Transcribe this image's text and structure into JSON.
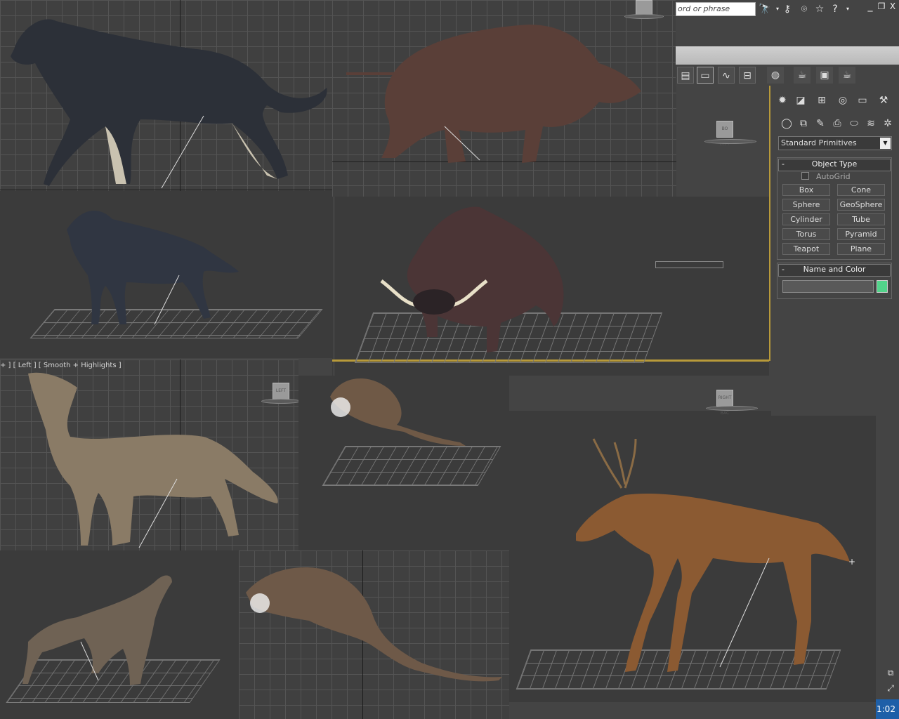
{
  "search": {
    "placeholder": "ord or phrase"
  },
  "viewport_label": "+ ] [ Left ] [ Smooth + Highlights ]",
  "viewcube": {
    "left": "LEFT",
    "front_left": "BO LEFT",
    "right_back": "RIGHT BAC"
  },
  "command_panel": {
    "category_dropdown": "Standard Primitives",
    "object_type": {
      "title": "Object Type",
      "autogrid_label": "AutoGrid",
      "buttons": [
        "Box",
        "Cone",
        "Sphere",
        "GeoSphere",
        "Cylinder",
        "Tube",
        "Torus",
        "Pyramid",
        "Teapot",
        "Plane"
      ]
    },
    "name_and_color": {
      "title": "Name and Color",
      "name_value": "",
      "swatch_color": "#52d38a"
    },
    "rollout_toggle": "-"
  },
  "window_controls": {
    "minimize": "_",
    "restore": "❐",
    "close": "X"
  },
  "status_clock": "1:02",
  "colors": {
    "accent_blue": "#1e5fa8",
    "viewport_border": "#b89a3a"
  }
}
